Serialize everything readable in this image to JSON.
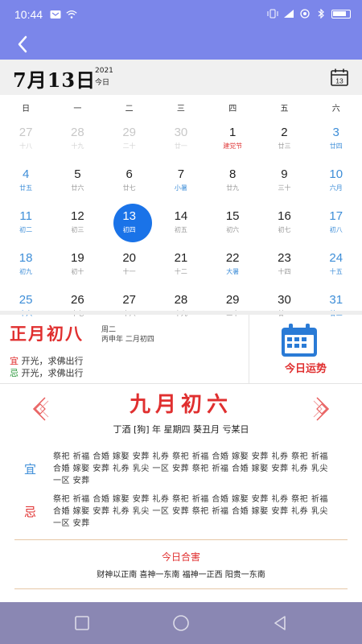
{
  "status_bar": {
    "time": "10:44",
    "icons": [
      "message-icon",
      "wifi-icon",
      "vibrate-icon",
      "signal-icon",
      "location-icon",
      "bluetooth-icon",
      "battery-icon"
    ]
  },
  "header": {
    "date_main": "7月13日",
    "year": "2021",
    "today_label": "今日",
    "calendar_icon_day": "13"
  },
  "weekdays": [
    "日",
    "一",
    "二",
    "三",
    "四",
    "五",
    "六"
  ],
  "calendar": {
    "rows": [
      [
        {
          "num": "27",
          "lunar": "十八",
          "muted": true
        },
        {
          "num": "28",
          "lunar": "十九",
          "muted": true
        },
        {
          "num": "29",
          "lunar": "二十",
          "muted": true
        },
        {
          "num": "30",
          "lunar": "廿一",
          "muted": true
        },
        {
          "num": "1",
          "lunar": "建党节",
          "lunar_color": "red"
        },
        {
          "num": "2",
          "lunar": "廿三"
        },
        {
          "num": "3",
          "lunar": "廿四",
          "weekend": true
        }
      ],
      [
        {
          "num": "4",
          "lunar": "廿五",
          "weekend": true
        },
        {
          "num": "5",
          "lunar": "廿六"
        },
        {
          "num": "6",
          "lunar": "廿七"
        },
        {
          "num": "7",
          "lunar": "小暑",
          "lunar_color": "blue"
        },
        {
          "num": "8",
          "lunar": "廿九"
        },
        {
          "num": "9",
          "lunar": "三十"
        },
        {
          "num": "10",
          "lunar": "六月",
          "weekend": true
        }
      ],
      [
        {
          "num": "11",
          "lunar": "初二",
          "weekend": true
        },
        {
          "num": "12",
          "lunar": "初三"
        },
        {
          "num": "13",
          "lunar": "初四",
          "selected": true
        },
        {
          "num": "14",
          "lunar": "初五"
        },
        {
          "num": "15",
          "lunar": "初六"
        },
        {
          "num": "16",
          "lunar": "初七"
        },
        {
          "num": "17",
          "lunar": "初八",
          "weekend": true
        }
      ],
      [
        {
          "num": "18",
          "lunar": "初九",
          "weekend": true
        },
        {
          "num": "19",
          "lunar": "初十"
        },
        {
          "num": "20",
          "lunar": "十一"
        },
        {
          "num": "21",
          "lunar": "十二"
        },
        {
          "num": "22",
          "lunar": "大暑",
          "lunar_color": "blue"
        },
        {
          "num": "23",
          "lunar": "十四"
        },
        {
          "num": "24",
          "lunar": "十五",
          "weekend": true
        }
      ],
      [
        {
          "num": "25",
          "lunar": "十六",
          "weekend": true
        },
        {
          "num": "26",
          "lunar": "十七"
        },
        {
          "num": "27",
          "lunar": "十八"
        },
        {
          "num": "28",
          "lunar": "十九"
        },
        {
          "num": "29",
          "lunar": "二十"
        },
        {
          "num": "30",
          "lunar": "廿一"
        },
        {
          "num": "31",
          "lunar": "廿二",
          "weekend": true
        }
      ]
    ]
  },
  "info": {
    "lunar_date": "正月初八",
    "weekday": "周二",
    "sub": "丙申年 二月初四",
    "yi_label": "宜",
    "yi_text": "开光，求佛出行",
    "ji_label": "忌",
    "ji_text": "开光，求佛出行",
    "fortune_label": "今日运势"
  },
  "detail": {
    "title": "九月初六",
    "ganzhi": "丁酒 [狗] 年  星期四  葵丑月  亏某日",
    "yi_label": "宜",
    "yi_text": "祭祀 祈福 合婚 嫁娶 安葬 礼券 祭祀 祈福 合婚 嫁娶 安葬 礼券 祭祀 祈福 合婚 嫁娶 安葬 礼券 乳尖 一区 安葬 祭祀 祈福 合婚 嫁娶 安葬 礼券 乳尖 一区 安葬",
    "ji_label": "忌",
    "ji_text": "祭祀 祈福 合婚 嫁娶 安葬 礼券 祭祀 祈福 合婚 嫁娶 安葬 礼券 祭祀 祈福 合婚 嫁娶 安葬 礼券 乳尖 一区 安葬 祭祀 祈福 合婚 嫁娶 安葬 礼券 乳尖 一区 安葬",
    "harm_title": "今日合害",
    "harm_text": "财神以正南 喜神一东南 福神一正西 阳贵一东南"
  },
  "colors": {
    "primary": "#7b86ea",
    "red": "#e02f2f",
    "blue": "#3e8ed8",
    "green": "#2e9a3e",
    "selected": "#1a73e8",
    "sys_nav": "#8a87b3"
  }
}
